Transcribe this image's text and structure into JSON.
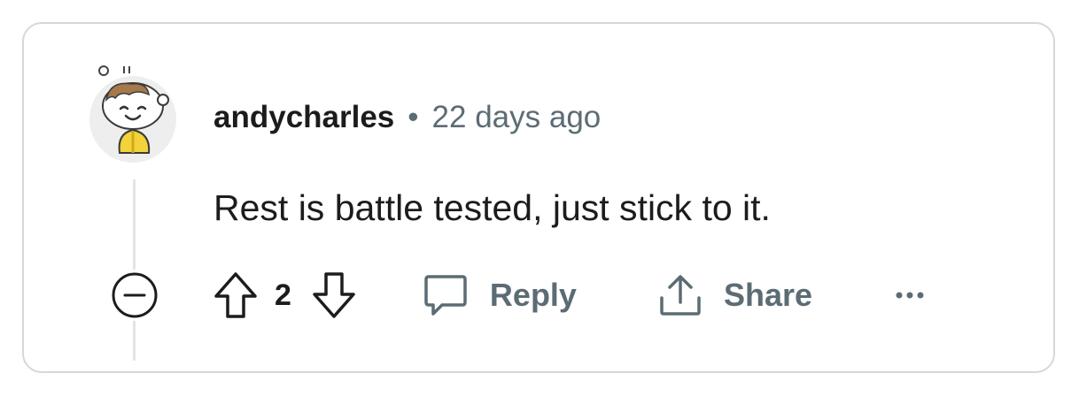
{
  "comment": {
    "author": "andycharles",
    "separator": "•",
    "timestamp": "22 days ago",
    "body": "Rest is battle tested, just stick to it.",
    "score": "2"
  },
  "actions": {
    "reply_label": "Reply",
    "share_label": "Share"
  },
  "icons": {
    "avatar": "snoo-avatar-icon",
    "collapse": "collapse-minus-icon",
    "upvote": "arrow-up-icon",
    "downvote": "arrow-down-icon",
    "reply": "speech-bubble-icon",
    "share": "share-upload-icon",
    "more": "ellipsis-icon"
  },
  "colors": {
    "text": "#1c1c1c",
    "muted": "#5c6c74",
    "border": "#d7d7d7",
    "thread_line": "#e4e4e4"
  }
}
